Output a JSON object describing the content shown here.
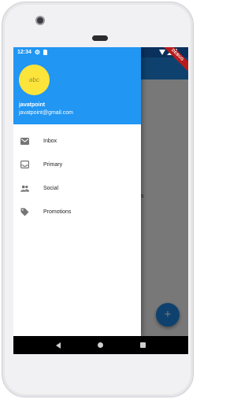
{
  "status_bar": {
    "time": "12:34"
  },
  "drawer": {
    "avatar_text": "abc",
    "account_name": "javatpoint",
    "account_email": "javatpoint@gmail.com",
    "items": [
      {
        "label": "Inbox",
        "icon": "mail-icon"
      },
      {
        "label": "Primary",
        "icon": "inbox-tray-icon"
      },
      {
        "label": "Social",
        "icon": "people-icon"
      },
      {
        "label": "Promotions",
        "icon": "tag-icon"
      }
    ]
  },
  "app": {
    "body_text": "s",
    "fab_label": "+",
    "debug_banner": "DEBUG"
  },
  "colors": {
    "drawer_header": "#2196f3",
    "avatar": "#fde43b",
    "fab": "#1e88e5",
    "app_bar": "#1e88e5"
  }
}
